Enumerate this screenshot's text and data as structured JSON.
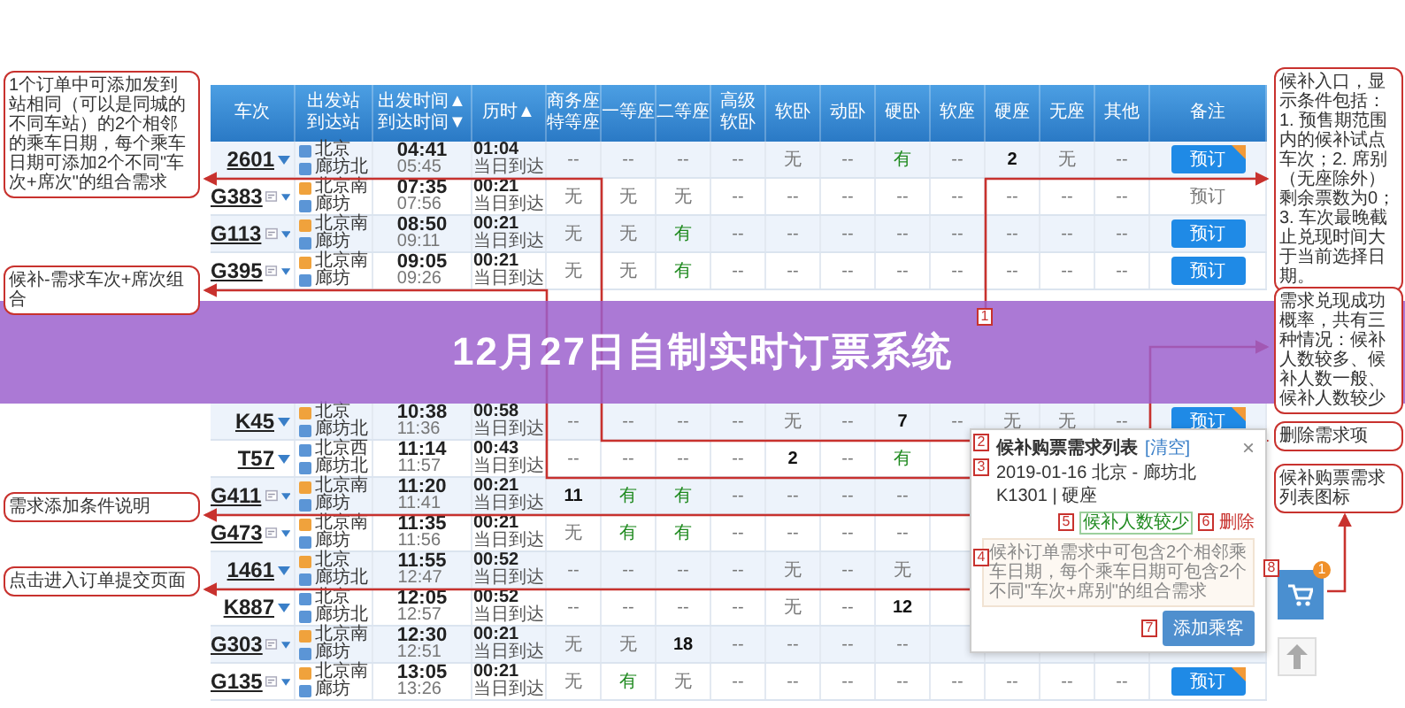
{
  "banner": {
    "title": "12月27日自制实时订票系统"
  },
  "table": {
    "columns": [
      [
        "车次"
      ],
      [
        "出发站",
        "到达站"
      ],
      [
        "出发时间▲",
        "到达时间▼"
      ],
      [
        "历时▲"
      ],
      [
        "商务座",
        "特等座"
      ],
      [
        "一等座"
      ],
      [
        "二等座"
      ],
      [
        "高级",
        "软卧"
      ],
      [
        "软卧"
      ],
      [
        "动卧"
      ],
      [
        "硬卧"
      ],
      [
        "软座"
      ],
      [
        "硬座"
      ],
      [
        "无座"
      ],
      [
        "其他"
      ],
      [
        "备注"
      ]
    ],
    "sections": [
      {
        "rows": [
          {
            "train": "2601",
            "emu": false,
            "from": "北京",
            "origin": false,
            "to": "廊坊北",
            "dep": "04:41",
            "arr": "05:45",
            "dur": "01:04",
            "arrive_note": "当日到达",
            "seats": [
              "--",
              "--",
              "--",
              "--",
              "无",
              "--",
              {
                "text": "有",
                "kind": "yes"
              },
              "--",
              {
                "text": "2",
                "kind": "count"
              },
              "无",
              "--"
            ],
            "booking": {
              "label": "预订",
              "enabled": true,
              "standby": true
            }
          },
          {
            "train": "G383",
            "emu": true,
            "from": "北京南",
            "origin": true,
            "to": "廊坊",
            "dep": "07:35",
            "arr": "07:56",
            "dur": "00:21",
            "arrive_note": "当日到达",
            "seats": [
              "无",
              "无",
              "无",
              "--",
              "--",
              "--",
              "--",
              "--",
              "--",
              "--",
              "--"
            ],
            "booking": {
              "label": "预订",
              "enabled": false,
              "standby": false
            }
          },
          {
            "train": "G113",
            "emu": true,
            "from": "北京南",
            "origin": true,
            "to": "廊坊",
            "dep": "08:50",
            "arr": "09:11",
            "dur": "00:21",
            "arrive_note": "当日到达",
            "seats": [
              "无",
              "无",
              {
                "text": "有",
                "kind": "yes"
              },
              "--",
              "--",
              "--",
              "--",
              "--",
              "--",
              "--",
              "--"
            ],
            "booking": {
              "label": "预订",
              "enabled": true,
              "standby": false
            }
          },
          {
            "train": "G395",
            "emu": true,
            "from": "北京南",
            "origin": true,
            "to": "廊坊",
            "dep": "09:05",
            "arr": "09:26",
            "dur": "00:21",
            "arrive_note": "当日到达",
            "seats": [
              "无",
              "无",
              {
                "text": "有",
                "kind": "yes"
              },
              "--",
              "--",
              "--",
              "--",
              "--",
              "--",
              "--",
              "--"
            ],
            "booking": {
              "label": "预订",
              "enabled": true,
              "standby": false
            }
          }
        ]
      },
      {
        "rows": [
          {
            "train": "K45",
            "emu": false,
            "from": "北京",
            "origin": true,
            "to": "廊坊北",
            "dep": "10:38",
            "arr": "11:36",
            "dur": "00:58",
            "arrive_note": "当日到达",
            "seats": [
              "--",
              "--",
              "--",
              "--",
              "无",
              "--",
              {
                "text": "7",
                "kind": "count"
              },
              "--",
              "无",
              "无",
              "--"
            ],
            "booking": {
              "label": "预订",
              "enabled": true,
              "standby": true
            }
          },
          {
            "train": "T57",
            "emu": false,
            "from": "北京西",
            "origin": false,
            "to": "廊坊北",
            "dep": "11:14",
            "arr": "11:57",
            "dur": "00:43",
            "arrive_note": "当日到达",
            "seats": [
              "--",
              "--",
              "--",
              "--",
              {
                "text": "2",
                "kind": "count"
              },
              "--",
              {
                "text": "有",
                "kind": "yes"
              }
            ]
          },
          {
            "train": "G411",
            "emu": true,
            "from": "北京南",
            "origin": true,
            "to": "廊坊",
            "dep": "11:20",
            "arr": "11:41",
            "dur": "00:21",
            "arrive_note": "当日到达",
            "seats": [
              {
                "text": "11",
                "kind": "count"
              },
              {
                "text": "有",
                "kind": "yes"
              },
              {
                "text": "有",
                "kind": "yes"
              },
              "--",
              "--",
              "--",
              "--"
            ]
          },
          {
            "train": "G473",
            "emu": true,
            "from": "北京南",
            "origin": true,
            "to": "廊坊",
            "dep": "11:35",
            "arr": "11:56",
            "dur": "00:21",
            "arrive_note": "当日到达",
            "seats": [
              "无",
              {
                "text": "有",
                "kind": "yes"
              },
              {
                "text": "有",
                "kind": "yes"
              },
              "--",
              "--",
              "--",
              "--"
            ]
          },
          {
            "train": "1461",
            "emu": false,
            "from": "北京",
            "origin": true,
            "to": "廊坊北",
            "dep": "11:55",
            "arr": "12:47",
            "dur": "00:52",
            "arrive_note": "当日到达",
            "seats": [
              "--",
              "--",
              "--",
              "--",
              "无",
              "--",
              "无"
            ]
          },
          {
            "train": "K887",
            "emu": false,
            "from": "北京",
            "origin": false,
            "to": "廊坊北",
            "dep": "12:05",
            "arr": "12:57",
            "dur": "00:52",
            "arrive_note": "当日到达",
            "seats": [
              "--",
              "--",
              "--",
              "--",
              "无",
              "--",
              {
                "text": "12",
                "kind": "count"
              }
            ]
          },
          {
            "train": "G303",
            "emu": true,
            "from": "北京南",
            "origin": true,
            "to": "廊坊",
            "dep": "12:30",
            "arr": "12:51",
            "dur": "00:21",
            "arrive_note": "当日到达",
            "seats": [
              "无",
              "无",
              {
                "text": "18",
                "kind": "count"
              },
              "--",
              "--",
              "--",
              "--"
            ]
          },
          {
            "train": "G135",
            "emu": true,
            "from": "北京南",
            "origin": true,
            "to": "廊坊",
            "dep": "13:05",
            "arr": "13:26",
            "dur": "00:21",
            "arrive_note": "当日到达",
            "seats": [
              "无",
              {
                "text": "有",
                "kind": "yes"
              },
              "无",
              "--",
              "--",
              "--",
              "--",
              "--",
              "--",
              "--",
              "--"
            ],
            "booking": {
              "label": "预订",
              "enabled": true,
              "standby": true
            }
          }
        ]
      }
    ]
  },
  "popup": {
    "title": "候补购票需求列表",
    "clear": "[清空]",
    "close": "×",
    "date_route": "2019-01-16 北京 - 廊坊北",
    "train_seat": "K1301 | 硬座",
    "chance": "候补人数较少",
    "delete": "删除",
    "note": "候补订单需求中可包含2个相邻乘车日期，每个乘车日期可包含2个不同\"车次+席别\"的组合需求",
    "button": "添加乘客"
  },
  "cart": {
    "count": "1"
  },
  "markers": [
    "1",
    "2",
    "3",
    "4",
    "5",
    "6",
    "7",
    "8"
  ],
  "notes": [
    {
      "text": "1个订单中可添加发到站相同（可以是同城的不同车站）的2个相邻的乘车日期，每个乘车日期可添加2个不同\"车次+席次\"的组合需求"
    },
    {
      "text": "候补-需求车次+席次组合"
    },
    {
      "text": "需求添加条件说明"
    },
    {
      "text": "点击进入订单提交页面"
    },
    {
      "text": "候补入口，显示条件包括：1. 预售期范围内的候补试点车次；2. 席别（无座除外）剩余票数为0；3. 车次最晚截止兑现时间大于当前选择日期。"
    },
    {
      "text": "需求兑现成功概率，共有三种情况：候补人数较多、候补人数一般、候补人数较少"
    },
    {
      "text": "删除需求项"
    },
    {
      "text": "候补购票需求列表图标"
    }
  ]
}
